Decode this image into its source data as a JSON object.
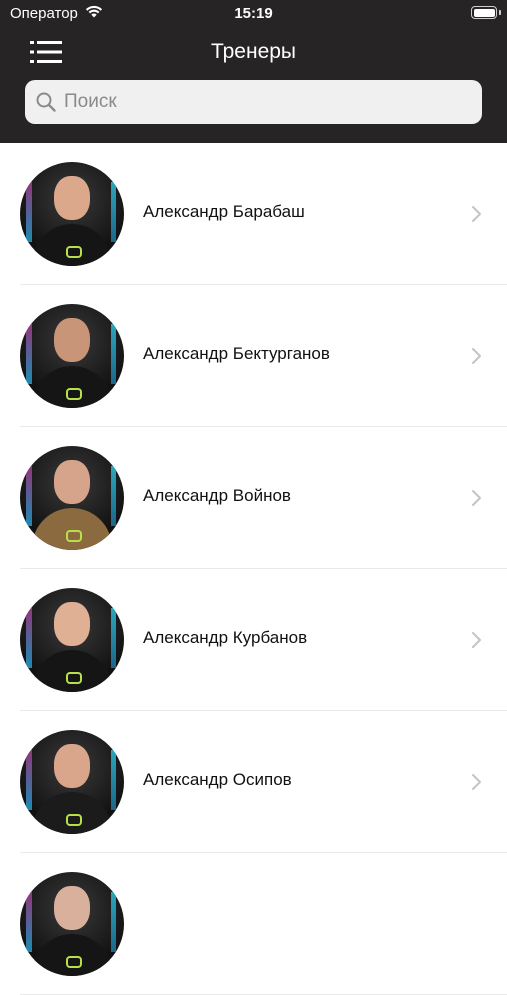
{
  "status_bar": {
    "carrier": "Оператор",
    "time": "15:19"
  },
  "header": {
    "title": "Тренеры",
    "menu_icon": "hamburger-menu-icon"
  },
  "search": {
    "placeholder": "Поиск",
    "value": ""
  },
  "trainers": [
    {
      "name": "Александр Барабаш",
      "jacket": "#151515",
      "head": "#dba88c"
    },
    {
      "name": "Александр Бектурганов",
      "jacket": "#151515",
      "head": "#c99578"
    },
    {
      "name": "Александр Войнов",
      "jacket": "#8a6a3e",
      "head": "#d6a48a"
    },
    {
      "name": "Александр Курбанов",
      "jacket": "#151515",
      "head": "#e0b094"
    },
    {
      "name": "Александр Осипов",
      "jacket": "#1b1b1b",
      "head": "#d9a68b"
    },
    {
      "name": "",
      "jacket": "#151515",
      "head": "#d8b09c"
    }
  ],
  "colors": {
    "header_bg": "#262424",
    "divider": "#e9e9e9",
    "chevron": "#c4c4c7",
    "accent_logo": "#b8e04a"
  }
}
